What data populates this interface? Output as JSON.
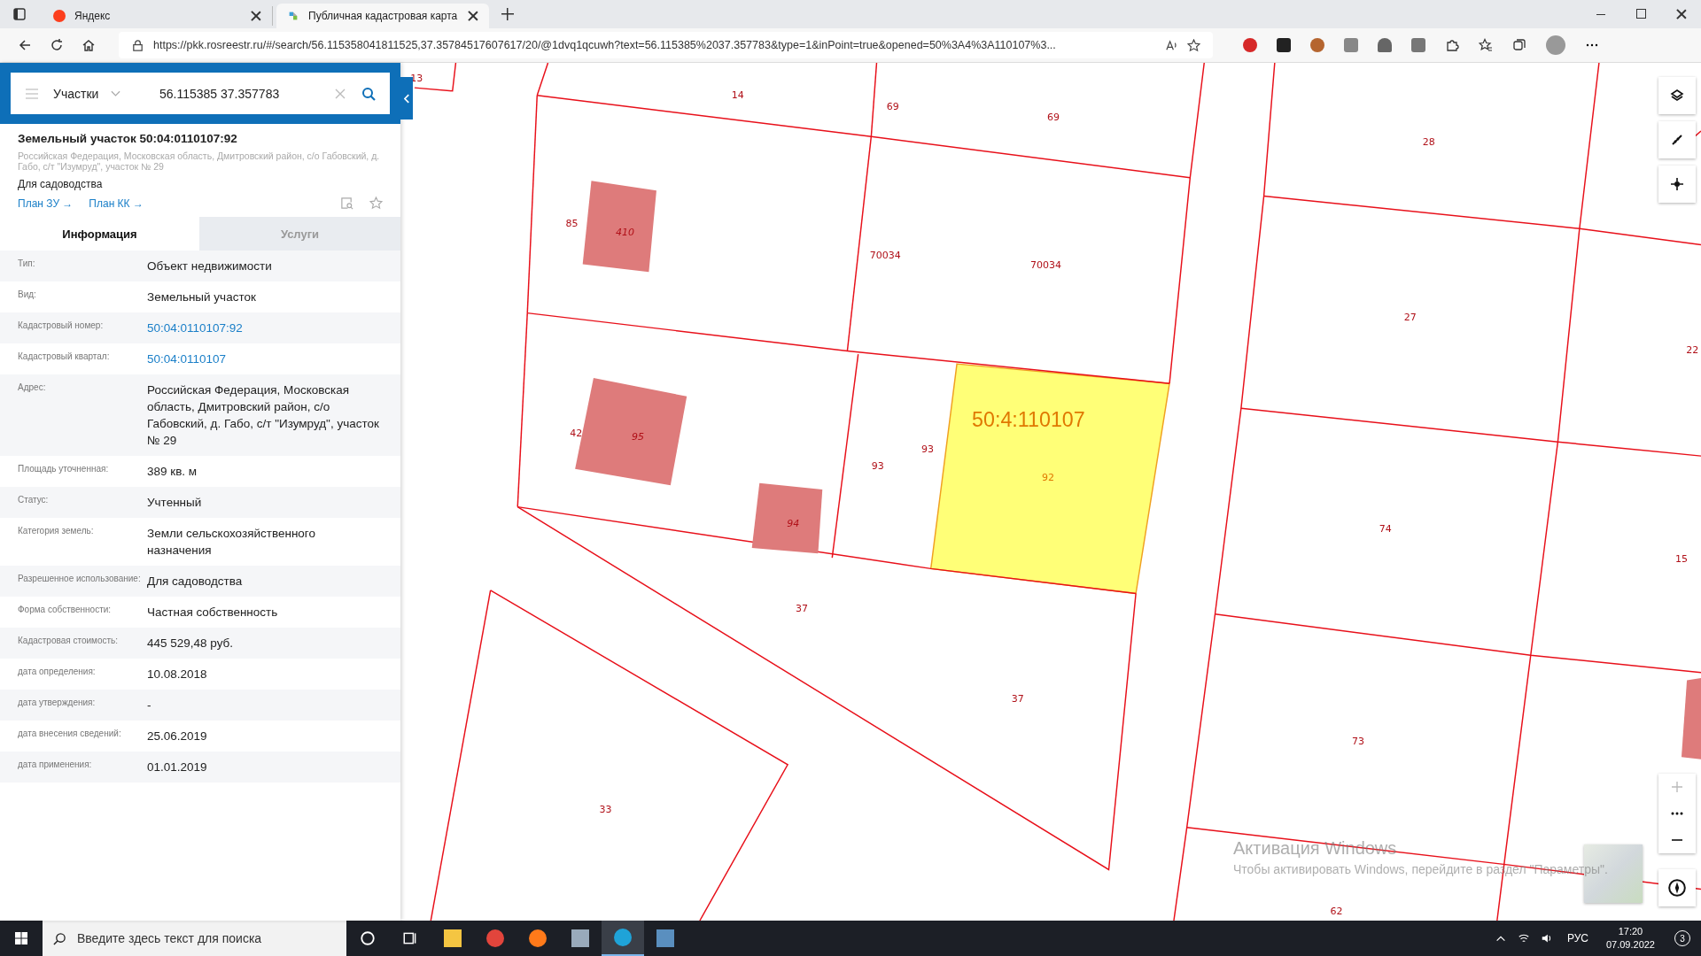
{
  "browser": {
    "tabs": [
      {
        "title": "Яндекс",
        "selected": false
      },
      {
        "title": "Публичная кадастровая карта",
        "selected": true
      }
    ],
    "url": "https://pkk.rosreestr.ru/#/search/56.115358041811525,37.35784517607617/20/@1dvq1qcuwh?text=56.115385%2037.357783&type=1&inPoint=true&opened=50%3A4%3A110107%3..."
  },
  "panel": {
    "search": {
      "category": "Участки",
      "value": "56.115385 37.357783"
    },
    "object": {
      "title": "Земельный участок 50:04:0110107:92",
      "address": "Российская Федерация, Московская область, Дмитровский район, с/о Габовский, д. Габо, с/т \"Изумруд\", участок № 29",
      "purpose": "Для садоводства",
      "links": [
        "План ЗУ →",
        "План КК →"
      ]
    },
    "tabs": [
      {
        "label": "Информация",
        "selected": true
      },
      {
        "label": "Услуги",
        "selected": false
      }
    ],
    "rows": [
      {
        "label": "Тип:",
        "value": "Объект недвижимости",
        "kind": "text"
      },
      {
        "label": "Вид:",
        "value": "Земельный участок",
        "kind": "text"
      },
      {
        "label": "Кадастровый номер:",
        "value": "50:04:0110107:92",
        "kind": "link"
      },
      {
        "label": "Кадастровый квартал:",
        "value": "50:04:0110107",
        "kind": "link"
      },
      {
        "label": "Адрес:",
        "value": "Российская Федерация, Московская область, Дмитровский район, с/о Габовский, д. Габо, с/т \"Изумруд\", участок № 29",
        "kind": "text"
      },
      {
        "label": "Площадь уточненная:",
        "value": "389 кв. м",
        "kind": "text"
      },
      {
        "label": "Статус:",
        "value": "Учтенный",
        "kind": "text"
      },
      {
        "label": "Категория земель:",
        "value": "Земли сельскохозяйственного назначения",
        "kind": "text"
      },
      {
        "label": "Разрешенное использование:",
        "value": "Для садоводства",
        "kind": "text"
      },
      {
        "label": "Форма собственности:",
        "value": "Частная собственность",
        "kind": "text"
      },
      {
        "label": "Кадастровая стоимость:",
        "value": "445 529,48 руб.",
        "kind": "text"
      },
      {
        "label": "дата определения:",
        "value": "10.08.2018",
        "kind": "text"
      },
      {
        "label": "дата утверждения:",
        "value": "-",
        "kind": "text"
      },
      {
        "label": "дата внесения сведений:",
        "value": "25.06.2019",
        "kind": "text"
      },
      {
        "label": "дата применения:",
        "value": "01.01.2019",
        "kind": "text"
      }
    ]
  },
  "map": {
    "parcel_labels": [
      "13",
      "14",
      "69",
      "69",
      "28",
      "85",
      "410",
      "70034",
      "70034",
      "27",
      "22",
      "42",
      "95",
      "93",
      "93",
      "94",
      "74",
      "15",
      "37",
      "37",
      "73",
      "33",
      "62"
    ],
    "quarter_label": "50:4:110107",
    "selected_parcel_label": "92",
    "activation": {
      "title": "Активация Windows",
      "text": "Чтобы активировать Windows, перейдите в раздел \"Параметры\"."
    }
  },
  "taskbar": {
    "search_placeholder": "Введите здесь текст для поиска",
    "language": "РУС",
    "time": "17:20",
    "date": "07.09.2022",
    "notifications": "3"
  }
}
